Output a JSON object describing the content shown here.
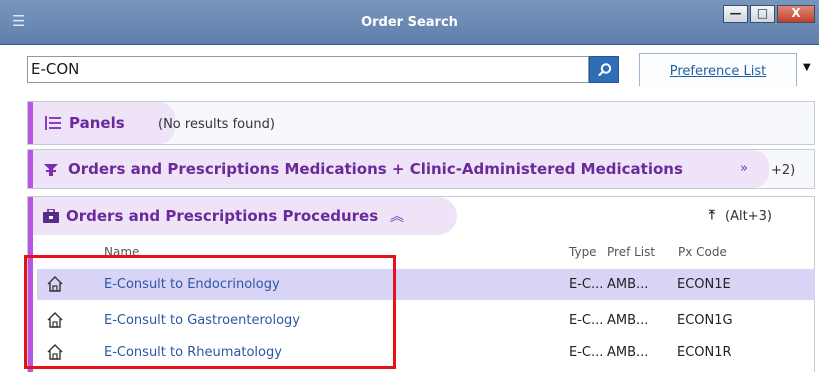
{
  "window": {
    "title": "Order Search",
    "minimize": "—",
    "maximize": "□",
    "close": "X"
  },
  "search": {
    "value": "E-CON",
    "preference_tab": "Preference List"
  },
  "panels": {
    "title": "Panels",
    "note": "(No results found)"
  },
  "medications": {
    "title": "Orders and Prescriptions Medications + Clinic-Administered Medications",
    "shortcut": "+2)"
  },
  "procedures": {
    "title": "Orders and Prescriptions Procedures",
    "shortcut": "(Alt+3)",
    "columns": {
      "name": "Name",
      "type": "Type",
      "pref_list": "Pref List",
      "px_code": "Px Code"
    },
    "rows": [
      {
        "name": "E-Consult to Endocrinology",
        "type": "E-C...",
        "pref": "AMB...",
        "px": "ECON1E",
        "selected": true
      },
      {
        "name": "E-Consult to Gastroenterology",
        "type": "E-C...",
        "pref": "AMB...",
        "px": "ECON1G",
        "selected": false
      },
      {
        "name": "E-Consult to Rheumatology",
        "type": "E-C...",
        "pref": "AMB...",
        "px": "ECON1R",
        "selected": false
      }
    ]
  },
  "colors": {
    "accent": "#b657e3",
    "link": "#2e56a5",
    "selection": "#d8d4f5",
    "highlight_box": "#e5121b"
  }
}
